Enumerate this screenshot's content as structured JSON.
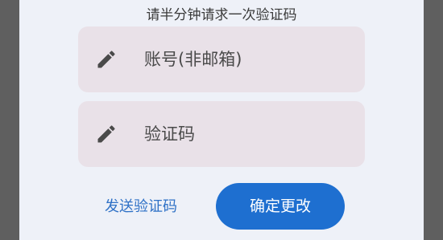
{
  "dialog": {
    "hint": "请半分钟请求一次验证码",
    "account_field": {
      "placeholder": "账号(非邮箱)",
      "icon": "pencil-icon"
    },
    "code_field": {
      "placeholder": "验证码",
      "icon": "pencil-icon"
    },
    "send_code_label": "发送验证码",
    "confirm_label": "确定更改"
  },
  "colors": {
    "backdrop": "#5f5f5f",
    "card": "#eef1f8",
    "field_bg": "#e9e1e8",
    "link": "#2f71c6",
    "primary": "#1e6fd0"
  }
}
